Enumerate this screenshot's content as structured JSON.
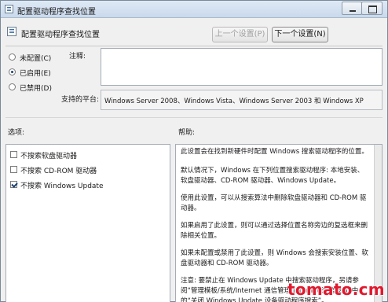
{
  "window": {
    "title": "配置驱动程序查找位置"
  },
  "header": {
    "title": "配置驱动程序查找位置",
    "prev_label": "上一个设置(P)",
    "next_label": "下一个设置(N)"
  },
  "state": {
    "options": [
      {
        "label": "未配置(C)",
        "checked": false
      },
      {
        "label": "已启用(E)",
        "checked": true
      },
      {
        "label": "已禁用(D)",
        "checked": false
      }
    ]
  },
  "comment": {
    "label": "注释:",
    "value": ""
  },
  "platform": {
    "label": "支持的平台:",
    "value": "Windows Server 2008、Windows Vista、Windows Server 2003 和 Windows XP"
  },
  "options_section": {
    "label": "选项:",
    "items": [
      {
        "label": "不搜索软盘驱动器",
        "checked": false
      },
      {
        "label": "不搜索 CD-ROM 驱动器",
        "checked": false
      },
      {
        "label": "不搜索 Windows Update",
        "checked": true
      }
    ]
  },
  "help_section": {
    "label": "帮助:",
    "paragraphs": [
      "此设置会在找到新硬件时配置 Windows 搜索驱动程序的位置。",
      "默认情况下，Windows 在下列位置搜索驱动程序: 本地安装、软盘驱动器、CD-ROM 驱动器、Windows Update。",
      "使用此设置，可以从搜索算法中删除软盘驱动器和 CD-ROM 驱动器。",
      "如果启用了此设置，则可以通过选择位置名称旁边的复选框来删除相关位置。",
      "如果未配置或禁用了此设置，则 Windows 会搜索安装位置、软盘驱动器和 CD-ROM 驱动器。",
      "注意: 要禁止在 Windows Update 中搜索驱动程序，另请参阅“管理模板/系统/Internet 通信管理/Internet 通信设置”中的“关闭 Windows Update 设备驱动程序搜索”。"
    ]
  },
  "watermark": {
    "text": "tomato.cm"
  },
  "colors": {
    "window_bg": "#f0f0f0",
    "titlebar": "#c9d9ec",
    "watermark": "#e0192e"
  }
}
